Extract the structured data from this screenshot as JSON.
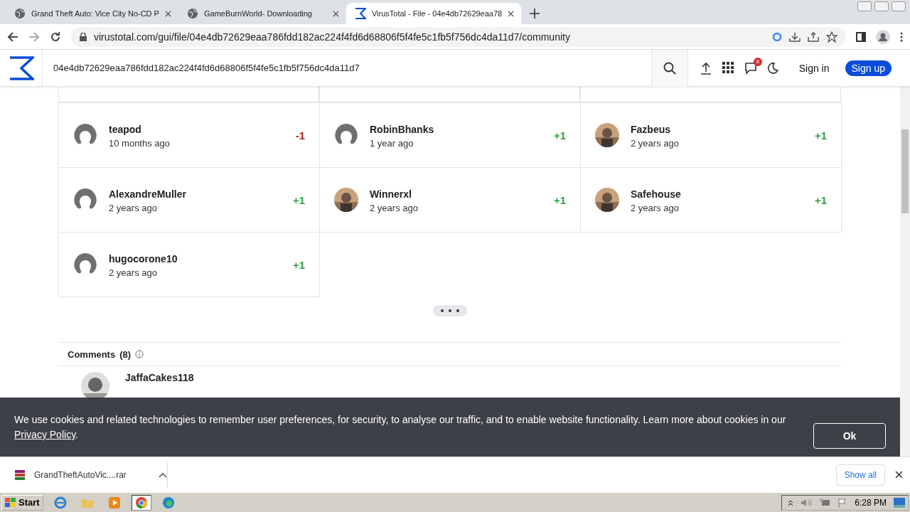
{
  "browser": {
    "tabs": [
      {
        "title": "Grand Theft Auto: Vice City No-CD P",
        "selected": false
      },
      {
        "title": "GameBurnWorld- Downloading",
        "selected": false
      },
      {
        "title": "VirusTotal - File - 04e4db72629eaa78",
        "selected": true
      }
    ],
    "address": "virustotal.com/gui/file/04e4db72629eaa786fdd182ac224f4fd6d68806f5f4fe5c1fb5f756dc4da11d7/community"
  },
  "header": {
    "search_value": "04e4db72629eaa786fdd182ac224f4fd6d68806f5f4fe5c1fb5f756dc4da11d7",
    "notification_count": "8",
    "sign_in": "Sign in",
    "sign_up": "Sign up"
  },
  "votes": [
    {
      "user": "teapod",
      "time": "10 months ago",
      "vote": "-1",
      "color": "#b71c1c",
      "kind": "default"
    },
    {
      "user": "RobinBhanks",
      "time": "1 year ago",
      "vote": "+1",
      "color": "#2e9e44",
      "kind": "default"
    },
    {
      "user": "Fazbeus",
      "time": "2 years ago",
      "vote": "+1",
      "color": "#2e9e44",
      "kind": "picture"
    },
    {
      "user": "AlexandreMuller",
      "time": "2 years ago",
      "vote": "+1",
      "color": "#2e9e44",
      "kind": "default"
    },
    {
      "user": "Winnerxl",
      "time": "2 years ago",
      "vote": "+1",
      "color": "#2e9e44",
      "kind": "picture"
    },
    {
      "user": "Safehouse",
      "time": "2 years ago",
      "vote": "+1",
      "color": "#2e9e44",
      "kind": "picture"
    },
    {
      "user": "hugocorone10",
      "time": "2 years ago",
      "vote": "+1",
      "color": "#2e9e44",
      "kind": "default"
    }
  ],
  "comments": {
    "title": "Comments",
    "count": "(8)",
    "items": [
      {
        "user": "JaffaCakes118"
      }
    ]
  },
  "cookie_banner": {
    "text": "We use cookies and related technologies to remember user preferences, for security, to analyse our traffic, and to enable website functionality. Learn more about cookies in our",
    "link": "Privacy Policy",
    "after": ".",
    "button": "Ok"
  },
  "downloads": {
    "file": "GrandTheftAutoVic....rar",
    "show_all": "Show all"
  },
  "taskbar": {
    "start": "Start",
    "clock": "6:28 PM"
  }
}
